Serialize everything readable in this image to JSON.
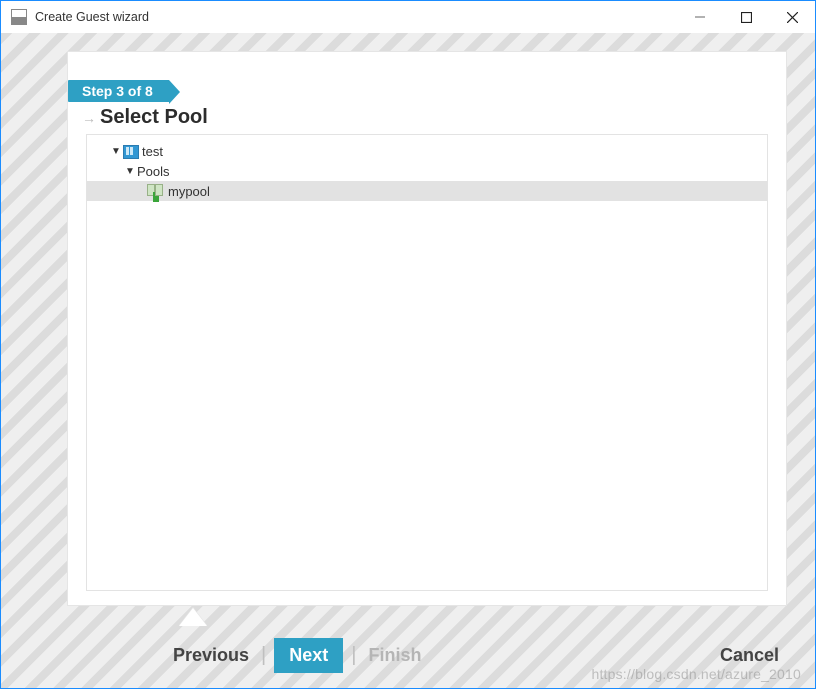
{
  "window": {
    "title": "Create Guest wizard"
  },
  "wizard": {
    "step_chip": "Step 3 of 8",
    "step_title": "Select Pool"
  },
  "tree": {
    "server": {
      "label": "test"
    },
    "pools_node": {
      "label": "Pools"
    },
    "selected_pool": {
      "label": "mypool"
    }
  },
  "buttons": {
    "previous": "Previous",
    "next": "Next",
    "finish": "Finish",
    "cancel": "Cancel"
  },
  "watermark": "https://blog.csdn.net/azure_2010"
}
